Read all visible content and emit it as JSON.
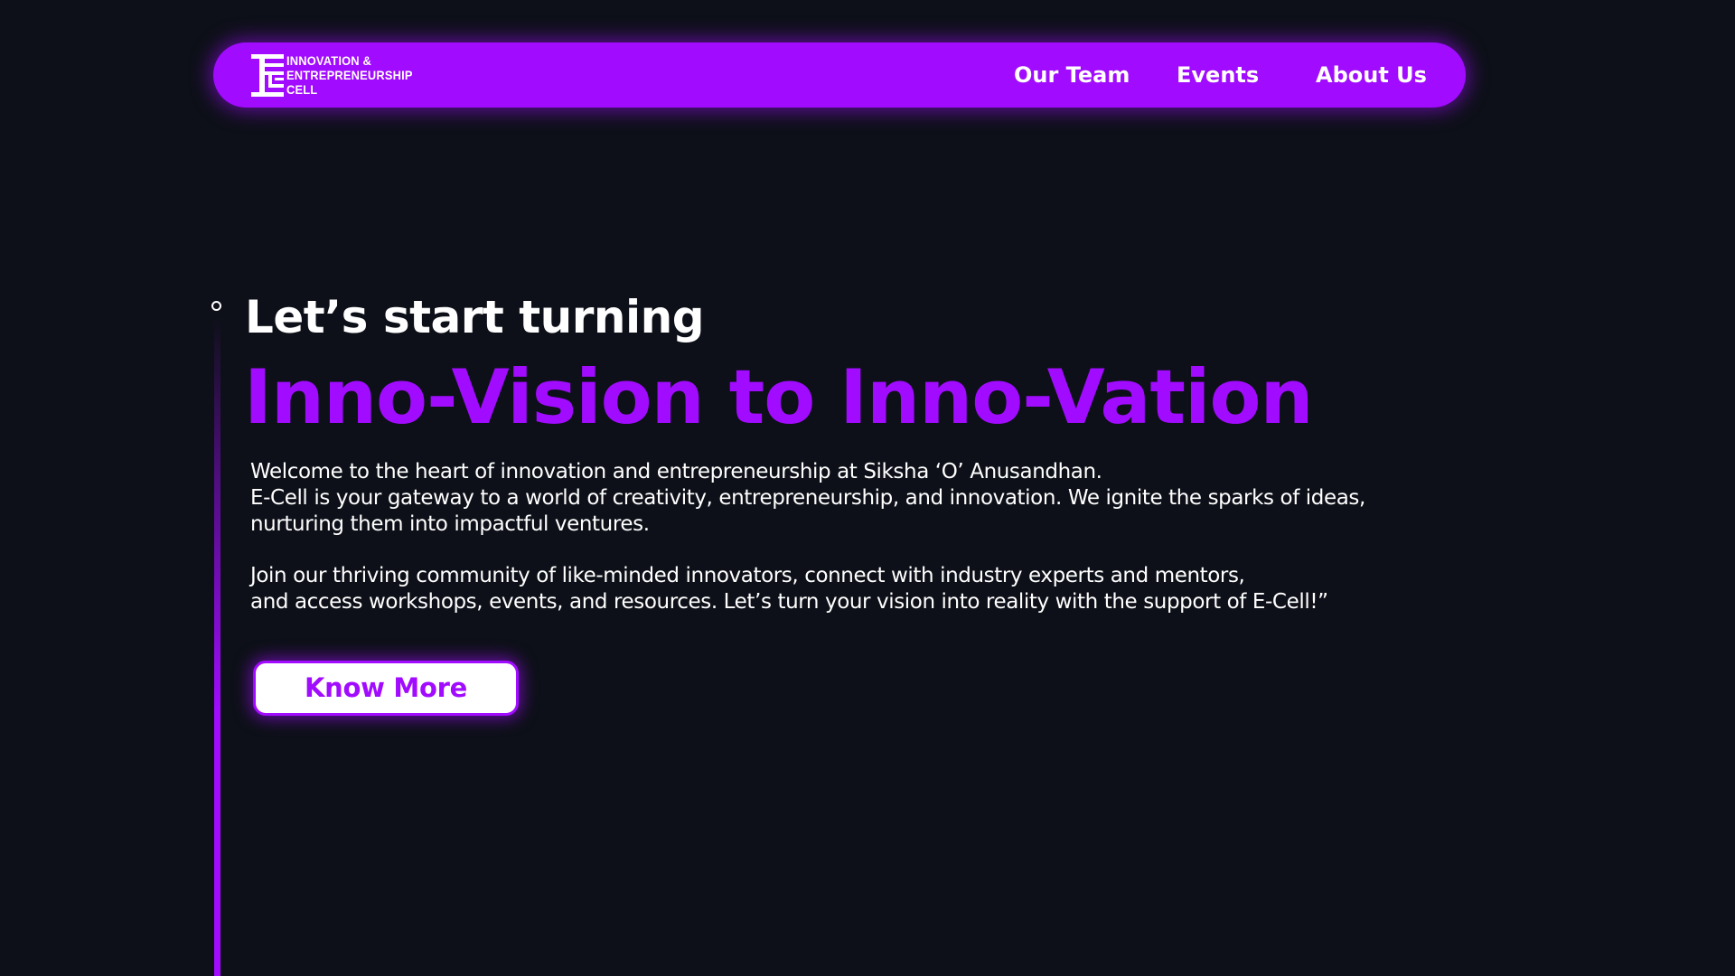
{
  "colors": {
    "background": "#0d1018",
    "accent": "#a10bff",
    "text": "#ffffff"
  },
  "navbar": {
    "logo": {
      "icon": "e-cell-logo-icon",
      "lines": [
        "INNOVATION &",
        "ENTREPRENEURSHIP",
        "CELL"
      ]
    },
    "links": [
      {
        "label": "Our Team"
      },
      {
        "label": "Events"
      },
      {
        "label": "About Us"
      }
    ]
  },
  "hero": {
    "kicker": "Let’s start turning",
    "title": "Inno-Vision to Inno-Vation",
    "paragraph1": [
      "Welcome to the heart of innovation and entrepreneurship at Siksha ‘O’ Anusandhan.",
      "E-Cell is your gateway to a world of creativity, entrepreneurship, and innovation. We ignite the sparks of ideas,",
      "nurturing them into impactful ventures."
    ],
    "paragraph2": [
      "Join our thriving community of like-minded innovators, connect with industry experts and mentors,",
      "and access workshops, events, and resources. Let’s turn your vision into reality with the support of E-Cell!”"
    ],
    "cta_label": "Know More"
  }
}
